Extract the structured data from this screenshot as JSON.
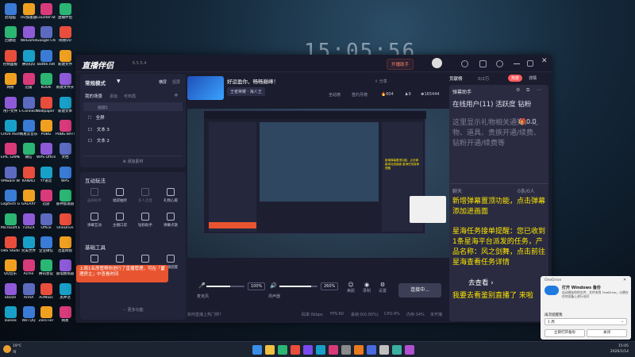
{
  "desktop": {
    "icons_col1": [
      "此电脑",
      "回收站",
      "控制面板",
      "网络",
      "用户文件",
      "CRU0 ASUS CPU-Z",
      "EPIC GAMES",
      "VMware Workstation",
      "Logitech G HUB",
      "Microsoft Edge",
      "OBS Studio",
      "QQ音乐",
      "Steam",
      "ToDesk"
    ],
    "icons_col2": [
      "UU加速器",
      "WeGame",
      "腾讯QQ",
      "迅雷",
      "L-Connect 3",
      "网易云音乐",
      "微信",
      "KANALI",
      "GALAXY",
      "TURZX",
      "完美世界",
      "Acme",
      "ArmA",
      "Win QQ"
    ],
    "icons_col3": [
      "Counter-Strike 2",
      "Google Chrome",
      "Battle.net",
      "KOOK",
      "Wallpaper Engine",
      "PUBG",
      "WPS Office",
      "YY语音",
      "迅游",
      "Office",
      "企业微信",
      "腾讯会议",
      "AirMass",
      "ZeroTier"
    ],
    "icons_col4": [
      "直播伴侣",
      "网易UU",
      "新建文件",
      "新建文件夹",
      "新建文本",
      "PUBG BATTLEGROUNDS",
      "文档",
      "WPS",
      "雷神加速器",
      "OneDrive",
      "百度网盘",
      "雷电模拟器",
      "黑神话",
      "网易"
    ],
    "icons_col5": [
      "文件",
      "完美世界竞技平台",
      "新建文件",
      "新建文件",
      "新建文件",
      "新建文件"
    ],
    "clock": "15:05:56"
  },
  "app": {
    "name": "直播伴侣",
    "version": "6.5.5.4",
    "start_live_label": "开播助手",
    "top_icons": [
      "chat-icon",
      "list-icon",
      "settings-icon",
      "minimize-icon",
      "maximize-icon",
      "close-icon"
    ]
  },
  "left": {
    "mode_label": "常规模式",
    "mode_tabs": [
      "横屏",
      "竖屏"
    ],
    "scenes_title": "我的场景",
    "scenes_actions": [
      "添加",
      "可布局"
    ],
    "scene_items": [
      "画面1",
      "全屏",
      "文本 3",
      "文本 2"
    ],
    "add_material": "添加素材",
    "interaction_title": "互动玩法",
    "interaction_items": [
      "画质助手",
      "福袋抽奖",
      "多人连麦",
      "礼物心愿",
      "弹幕互动",
      "主播口袋",
      "钻粉助手",
      "弹幕点歌"
    ],
    "basic_title": "基础工具",
    "basic_items": [
      "弹幕库",
      "房管助手",
      "直播间提醒",
      "下播提醒"
    ],
    "more_label": "更多功能",
    "tip_text": "上周1名房管帮你进行了直播管理，可在「管理房主」中查看时间",
    "tip_badge": "1"
  },
  "center": {
    "banner_line1": "好运盈你，畅畅巅峰！",
    "game_tag": "王者荣耀 · 海人王",
    "platform": "全站榜",
    "rank_label": "签约月榜",
    "stats": [
      "604",
      "9",
      "165444"
    ],
    "share": "分享",
    "mic_label": "麦克风",
    "mic_value": "100%",
    "sys_label": "扬声器",
    "sys_value": "260%",
    "tools": [
      "美颜",
      "录制",
      "设置"
    ],
    "connect_label": "连接中...",
    "status_items": [
      "如何直播上热门呀?",
      "码率:0kbps",
      "FPS:60",
      "丢帧:0(0.00%)",
      "CPU:4%",
      "内存:34%",
      "未开播"
    ]
  },
  "right": {
    "tabs": [
      "贡献榜",
      "0/2万"
    ],
    "fans_label": "热度",
    "detail_label": "详情",
    "assistant_title": "弹幕助手",
    "online_line": "在线用户(11) 活跃度 钻粉",
    "gift_count": "0.0",
    "gift_hint": "这里显示礼物相关通知，礼物、道具、贵族开通/续费、钻粉开通/续费等",
    "chat_title": "聊天",
    "chat_count": "0条/0人",
    "msg1": "新增弹幕置顶功能，点击弹幕添加进画面",
    "msg2": "星海任务接单提醒：您已收到1条星海平台派发的任务，产品名称：风之剑舞，点击前往星海查看任务详情",
    "msg2_link": "去查看",
    "msg3": "我要去看鉴别直播了 来啦"
  },
  "onedrive": {
    "title": "OneDrive",
    "head": "打开 Windows 备份",
    "body": "自动保存你的文件、文件夹到 OneDrive，以便在任何设备上进行访问",
    "q": "再次提醒我",
    "select": "1 周",
    "btn_primary": "立即打开备份",
    "btn_secondary": "关闭"
  },
  "taskbar": {
    "weather_temp": "19°C",
    "weather_desc": "晴",
    "time": "15:05",
    "date": "2026/1/14"
  },
  "colors": {
    "accent": "#5b8cff",
    "primary_button": "#7a4af0",
    "barrage": "#ffe600",
    "danger": "#ff5b5b"
  }
}
